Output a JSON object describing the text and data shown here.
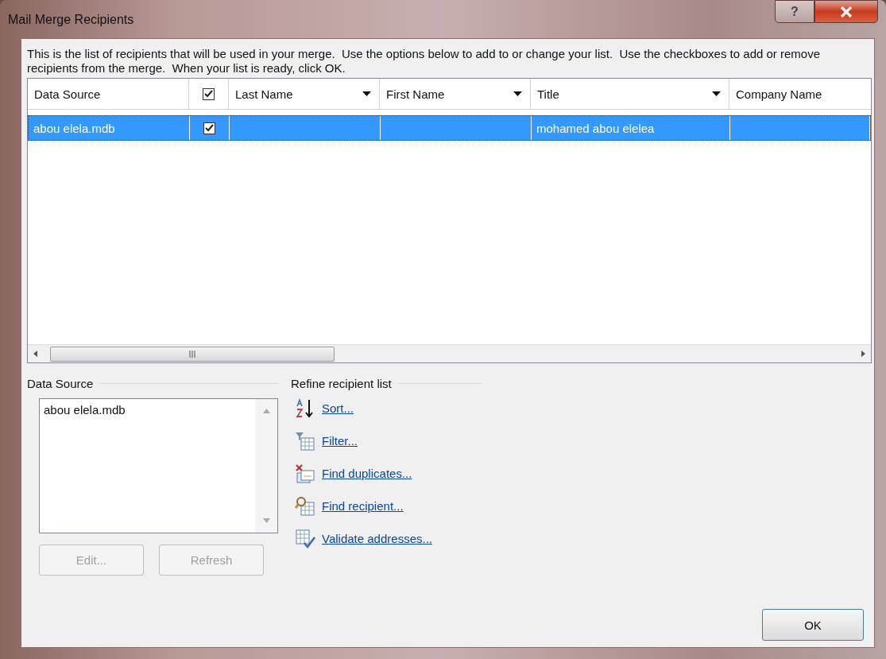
{
  "window": {
    "title": "Mail Merge Recipients",
    "help_button": "?"
  },
  "instructions": "This is the list of recipients that will be used in your merge.  Use the options below to add to or change your list.  Use the checkboxes to add or remove recipients from the merge.  When your list is ready, click OK.",
  "table": {
    "columns": [
      {
        "label": "Data Source",
        "kind": "text",
        "dropdown": false
      },
      {
        "kind": "check",
        "checked": true
      },
      {
        "label": "Last Name",
        "kind": "text",
        "dropdown": true
      },
      {
        "label": "First Name",
        "kind": "text",
        "dropdown": true
      },
      {
        "label": "Title",
        "kind": "text",
        "dropdown": true
      },
      {
        "label": "Company Name",
        "kind": "text",
        "dropdown": false
      }
    ],
    "rows": [
      {
        "selected": true,
        "checked": true,
        "data_source": "abou elela.mdb",
        "last_name": "",
        "first_name": "",
        "title": "mohamed abou elelea",
        "company_name": ""
      }
    ]
  },
  "data_source": {
    "label": "Data Source",
    "items": [
      "abou elela.mdb"
    ],
    "buttons": [
      {
        "label": "Edit...",
        "disabled": true
      },
      {
        "label": "Refresh",
        "disabled": true
      }
    ]
  },
  "refine": {
    "label": "Refine recipient list",
    "links": [
      {
        "label": "Sort...",
        "kind": "sort"
      },
      {
        "label": "Filter...",
        "kind": "filter"
      },
      {
        "label": "Find duplicates...",
        "kind": "duplicates"
      },
      {
        "label": "Find recipient...",
        "kind": "find"
      },
      {
        "label": "Validate addresses...",
        "kind": "validate"
      }
    ]
  },
  "ok_button": "OK"
}
